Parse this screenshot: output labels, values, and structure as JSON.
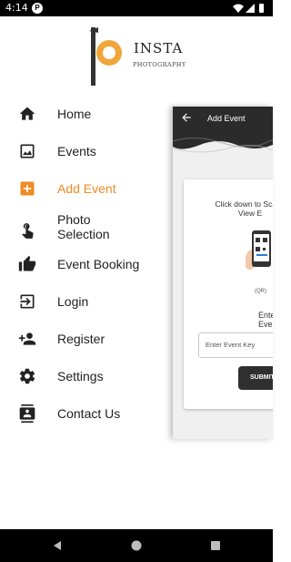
{
  "status_bar": {
    "time": "4:14",
    "app_icon_letter": "P"
  },
  "logo": {
    "brand_name": "INSTA",
    "brand_sub": "PHOTOGRAPHY"
  },
  "menu": {
    "items": [
      {
        "label": "Home",
        "icon": "home-icon"
      },
      {
        "label": "Events",
        "icon": "image-icon"
      },
      {
        "label": "Add Event",
        "icon": "add-box-icon"
      },
      {
        "label": "Photo Selection",
        "icon": "touch-icon"
      },
      {
        "label": "Event Booking",
        "icon": "thumbs-up-icon"
      },
      {
        "label": "Login",
        "icon": "login-icon"
      },
      {
        "label": "Register",
        "icon": "person-add-icon"
      },
      {
        "label": "Settings",
        "icon": "gear-icon"
      },
      {
        "label": "Contact Us",
        "icon": "contact-icon"
      }
    ],
    "active_index": 2,
    "active_color": "#f08a24"
  },
  "underlying_screen": {
    "title": "Add Event",
    "scan_text": "Click down to Sca to View E",
    "qr_label": "(QR)",
    "enter_text": "Enter Even",
    "input_placeholder": "Enter Event Key",
    "submit_label": "SUBMIT"
  },
  "colors": {
    "accent": "#f08a24",
    "appbar": "#2b2b2b"
  }
}
